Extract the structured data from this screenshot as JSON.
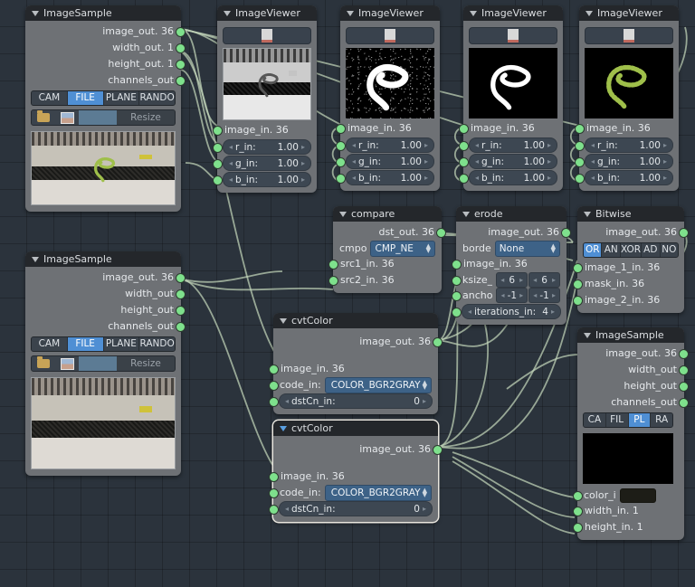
{
  "app": {
    "canvas_name": "node-editor-canvas"
  },
  "colors": {
    "canvas_bg": "#2b333c",
    "node_body": "#6e7175",
    "node_header": "#24272b",
    "socket_green": "#7ee08c",
    "link_green": "#c3d6bc",
    "accent_blue": "#4f8fd4",
    "dropdown_blue": "#3d6287"
  },
  "nodes": [
    {
      "id": "imagesample-1",
      "title": "ImageSample",
      "outputs": [
        {
          "label": "image_out. 36"
        },
        {
          "label": "width_out. 1"
        },
        {
          "label": "height_out. 1"
        },
        {
          "label": "channels_out"
        }
      ],
      "enum": {
        "options": [
          "CAM",
          "FILE",
          "PLANE",
          "RANDO"
        ],
        "selected": "FILE"
      },
      "file_row": {
        "folder_icon": "folder-icon",
        "thumb_icon": "image-thumb-icon",
        "path_value": "",
        "resize_label": "Resize"
      },
      "preview": "scene-color-with-worm"
    },
    {
      "id": "imageviewer-1",
      "title": "ImageViewer",
      "preview": "scene-gray",
      "inputs": [
        {
          "label": "image_in. 36",
          "type": "socket"
        },
        {
          "label": "r_in:",
          "value": "1.00",
          "type": "number"
        },
        {
          "label": "g_in:",
          "value": "1.00",
          "type": "number"
        },
        {
          "label": "b_in:",
          "value": "1.00",
          "type": "number"
        }
      ]
    },
    {
      "id": "imageviewer-2",
      "title": "ImageViewer",
      "preview": "black-noise-white-worm",
      "inputs": [
        {
          "label": "image_in. 36",
          "type": "socket"
        },
        {
          "label": "r_in:",
          "value": "1.00",
          "type": "number"
        },
        {
          "label": "g_in:",
          "value": "1.00",
          "type": "number"
        },
        {
          "label": "b_in:",
          "value": "1.00",
          "type": "number"
        }
      ]
    },
    {
      "id": "imageviewer-3",
      "title": "ImageViewer",
      "preview": "black-white-worm",
      "inputs": [
        {
          "label": "image_in. 36",
          "type": "socket"
        },
        {
          "label": "r_in:",
          "value": "1.00",
          "type": "number"
        },
        {
          "label": "g_in:",
          "value": "1.00",
          "type": "number"
        },
        {
          "label": "b_in:",
          "value": "1.00",
          "type": "number"
        }
      ]
    },
    {
      "id": "imageviewer-4",
      "title": "ImageViewer",
      "preview": "black-green-worm",
      "inputs": [
        {
          "label": "image_in. 36",
          "type": "socket"
        },
        {
          "label": "r_in:",
          "value": "1.00",
          "type": "number"
        },
        {
          "label": "g_in:",
          "value": "1.00",
          "type": "number"
        },
        {
          "label": "b_in:",
          "value": "1.00",
          "type": "number"
        }
      ]
    },
    {
      "id": "compare",
      "title": "compare",
      "output": {
        "label": "dst_out. 36"
      },
      "prop": {
        "label": "cmpo",
        "value": "CMP_NE"
      },
      "inputs": [
        {
          "label": "src1_in. 36"
        },
        {
          "label": "src2_in. 36"
        }
      ]
    },
    {
      "id": "erode",
      "title": "erode",
      "output": {
        "label": "image_out. 36"
      },
      "prop": {
        "label": "borde",
        "value": "None"
      },
      "image_in": "image_in. 36",
      "ksize": {
        "label": "ksize_",
        "v1": "6",
        "v2": "6"
      },
      "anchor": {
        "label": "ancho",
        "v1": "-1",
        "v2": "-1"
      },
      "iterations": {
        "label": "iterations_in:",
        "value": "4"
      }
    },
    {
      "id": "bitwise",
      "title": "Bitwise",
      "output": {
        "label": "image_out. 36"
      },
      "enum": {
        "options": [
          "OR",
          "AN",
          "XOR",
          "AD",
          "NO"
        ],
        "selected": "OR"
      },
      "inputs": [
        {
          "label": "image_1_in. 36"
        },
        {
          "label": "mask_in. 36"
        },
        {
          "label": "image_2_in. 36"
        }
      ]
    },
    {
      "id": "cvtcolor-1",
      "title": "cvtColor",
      "selected": false,
      "output": {
        "label": "image_out. 36"
      },
      "image_in": "image_in. 36",
      "code_in": {
        "label": "code_in:",
        "value": "COLOR_BGR2GRAY"
      },
      "dstcn": {
        "label": "dstCn_in:",
        "value": "0"
      }
    },
    {
      "id": "cvtcolor-2",
      "title": "cvtColor",
      "selected": true,
      "output": {
        "label": "image_out. 36"
      },
      "image_in": "image_in. 36",
      "code_in": {
        "label": "code_in:",
        "value": "COLOR_BGR2GRAY"
      },
      "dstcn": {
        "label": "dstCn_in:",
        "value": "0"
      }
    },
    {
      "id": "imagesample-2",
      "title": "ImageSample",
      "outputs": [
        {
          "label": "image_out. 36"
        },
        {
          "label": "width_out"
        },
        {
          "label": "height_out"
        },
        {
          "label": "channels_out"
        }
      ],
      "enum": {
        "options": [
          "CAM",
          "FILE",
          "PLANE",
          "RANDO"
        ],
        "selected": "FILE"
      },
      "file_row": {
        "folder_icon": "folder-icon",
        "thumb_icon": "image-thumb-icon",
        "path_value": "",
        "resize_label": "Resize"
      },
      "preview": "scene-color-plain"
    },
    {
      "id": "imagesample-3",
      "title": "ImageSample",
      "outputs": [
        {
          "label": "image_out. 36"
        },
        {
          "label": "width_out"
        },
        {
          "label": "height_out"
        },
        {
          "label": "channels_out"
        }
      ],
      "enum": {
        "options": [
          "CA",
          "FIL",
          "PL",
          "RA"
        ],
        "selected": "PL"
      },
      "preview": "black",
      "inputs": [
        {
          "label": "color_i",
          "type": "color",
          "swatch": "#1d1d17"
        },
        {
          "label": "width_in. 1",
          "type": "socket"
        },
        {
          "label": "height_in. 1",
          "type": "socket"
        }
      ]
    }
  ]
}
